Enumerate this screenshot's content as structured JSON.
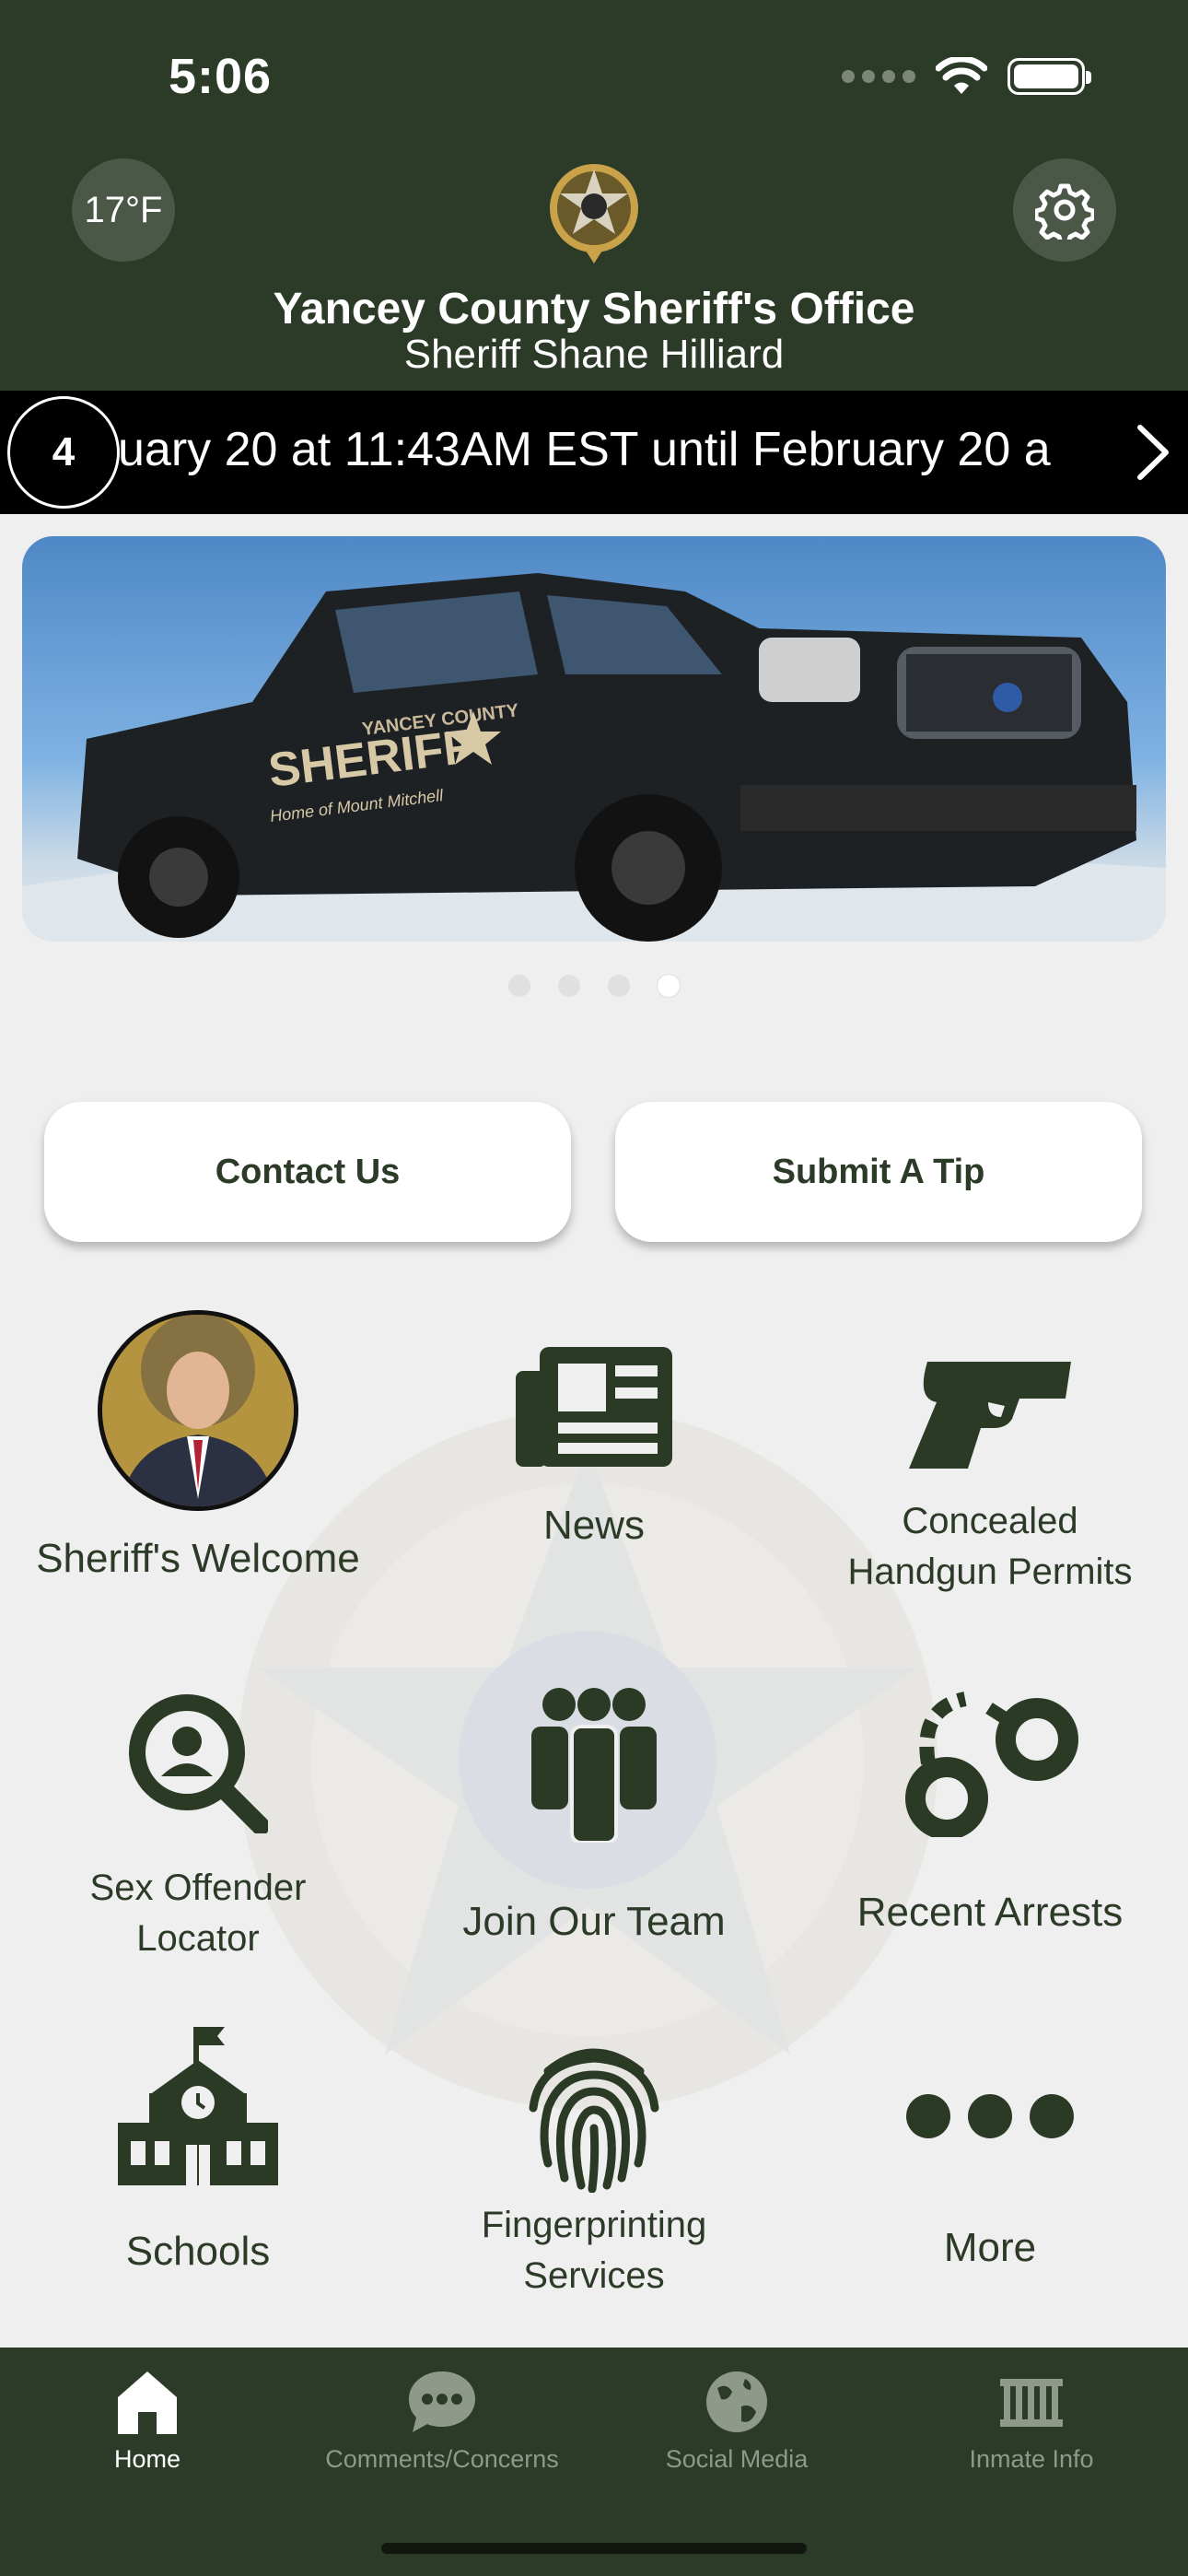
{
  "status_bar": {
    "time": "5:06"
  },
  "header": {
    "temperature": "17°F",
    "title": "Yancey County Sheriff's Office",
    "subtitle": "Sheriff Shane Hilliard",
    "background": "#2c3b27"
  },
  "ticker": {
    "count": "4",
    "text": "uary 20 at 11:43AM EST until February 20 a"
  },
  "carousel": {
    "truck_text": [
      "YANCEY COUNTY",
      "SHERIFF",
      "Home of Mount Mitchell"
    ],
    "slides": 4,
    "active_slide": 4
  },
  "buttons": {
    "contact": "Contact Us",
    "tip": "Submit A Tip"
  },
  "grid": {
    "sheriff_welcome": "Sheriff's Welcome",
    "news": "News",
    "concealed_1": "Concealed",
    "concealed_2": "Handgun Permits",
    "sex_offender_1": "Sex Offender",
    "sex_offender_2": "Locator",
    "join_team": "Join Our Team",
    "recent_arrests": "Recent Arrests",
    "schools": "Schools",
    "fingerprinting_1": "Fingerprinting",
    "fingerprinting_2": "Services",
    "more": "More"
  },
  "tabbar": {
    "home": "Home",
    "comments": "Comments/Concerns",
    "social": "Social Media",
    "inmate": "Inmate Info"
  },
  "colors": {
    "primary": "#2c3b27",
    "icon": "#2a3a25",
    "background": "#efefef"
  }
}
